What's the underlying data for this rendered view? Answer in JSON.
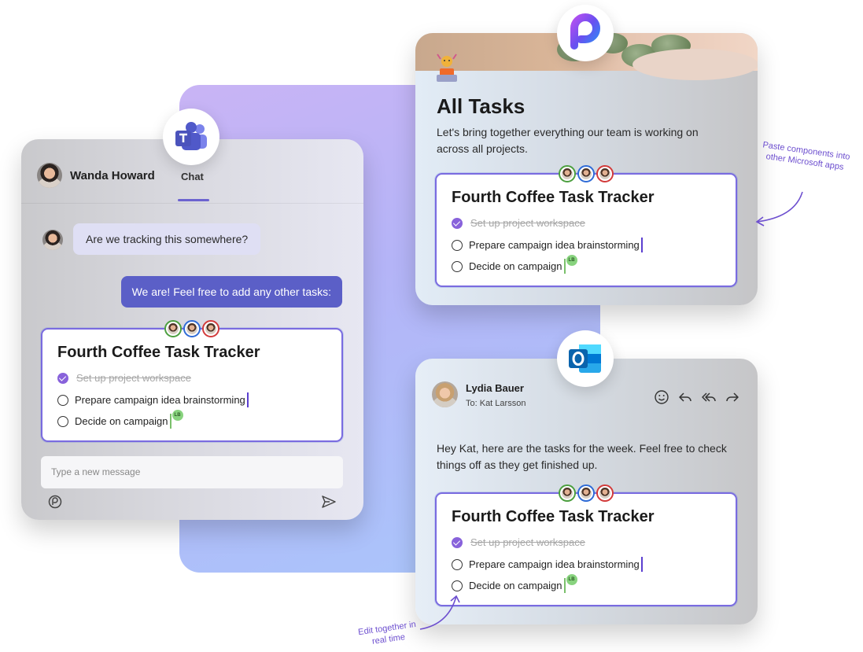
{
  "teams": {
    "contact_name": "Wanda Howard",
    "tab_label": "Chat",
    "messages": [
      {
        "from": "in",
        "text": "Are we tracking this somewhere?"
      },
      {
        "from": "out",
        "text": "We are! Feel free to add any other tasks:"
      }
    ],
    "compose_placeholder": "Type a new message"
  },
  "tracker": {
    "title": "Fourth Coffee Task Tracker",
    "tasks": [
      {
        "label": "Set up project workspace",
        "done": true
      },
      {
        "label": "Prepare campaign idea brainstorming",
        "done": false
      },
      {
        "label": "Decide on campaign",
        "done": false
      }
    ],
    "coauthor_initials": "LB"
  },
  "loop": {
    "title": "All Tasks",
    "description": "Let's bring together everything our team is working on across all projects."
  },
  "outlook": {
    "sender_name": "Lydia Bauer",
    "recipient": "To: Kat Larsson",
    "body": "Hey Kat, here are the tasks for the week. Feel free to check things off as they get finished up.",
    "actions": [
      "emoji-icon",
      "reply-icon",
      "reply-all-icon",
      "forward-icon"
    ]
  },
  "annotations": {
    "paste": "Paste components into other Microsoft apps",
    "edit": "Edit together in real time"
  },
  "colors": {
    "accent_purple": "#5b5fc7",
    "check_purple": "#8862db",
    "annotation_purple": "#6d4fcf",
    "coauthor_green": "#88d37e"
  }
}
